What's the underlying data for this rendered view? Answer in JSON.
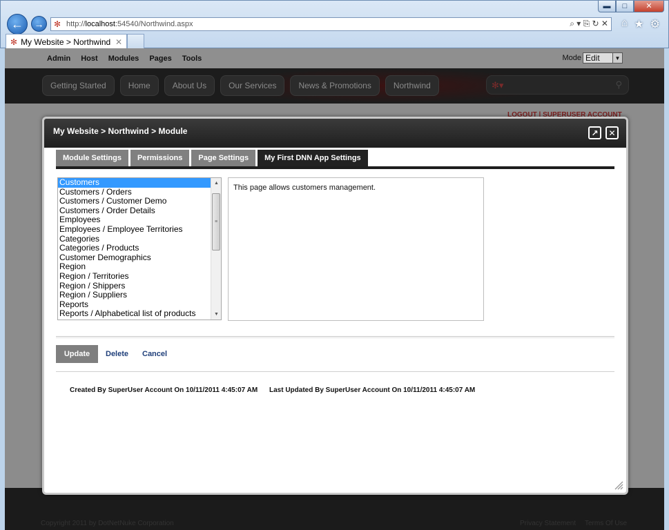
{
  "browser": {
    "url_prefix": "http://",
    "url_host": "localhost",
    "url_rest": ":54540/Northwind.aspx",
    "tab_title": "My Website > Northwind",
    "min_glyph": "▬",
    "max_glyph": "□",
    "close_glyph": "✕",
    "back_glyph": "←",
    "fwd_glyph": "→",
    "addr_tools": "⌕ ▾ ⎘ ↻ ✕",
    "toolbar": [
      "⌂",
      "★",
      "⚙"
    ]
  },
  "control_bar": {
    "menu": [
      "Admin",
      "Host",
      "Modules",
      "Pages",
      "Tools"
    ],
    "mode_label": "Mode",
    "mode_value": "Edit"
  },
  "site_nav": {
    "items": [
      "Getting Started",
      "Home",
      "About Us",
      "Our Services",
      "News & Promotions",
      "Northwind"
    ]
  },
  "login_links": "LOGOUT  |  SUPERUSER ACCOUNT",
  "footer": {
    "copyright": "Copyright 2011 by DotNetNuke Corporation",
    "privacy": "Privacy Statement",
    "terms": "Terms Of Use"
  },
  "modal": {
    "title": "My Website > Northwind > Module",
    "tabs": [
      "Module Settings",
      "Permissions",
      "Page Settings",
      "My First DNN App Settings"
    ],
    "active_tab": 3,
    "list_items": [
      "Customers",
      "Customers / Orders",
      "Customers / Customer Demo",
      "Customers / Order Details",
      "Employees",
      "Employees / Employee Territories",
      "Categories",
      "Categories / Products",
      "Customer Demographics",
      "Region",
      "Region / Territories",
      "Region / Shippers",
      "Region / Suppliers",
      "Reports",
      "Reports / Alphabetical list of products"
    ],
    "selected_index": 0,
    "description": "This page allows customers management.",
    "buttons": {
      "update": "Update",
      "delete": "Delete",
      "cancel": "Cancel"
    },
    "created": "Created By SuperUser Account On 10/11/2011 4:45:07 AM",
    "updated": "Last Updated By SuperUser Account On 10/11/2011 4:45:07 AM"
  },
  "colors": {
    "accent_selected": "#3399ff",
    "tab_active": "#222222",
    "tab_inactive": "#808080",
    "link": "#1f3f7a"
  }
}
